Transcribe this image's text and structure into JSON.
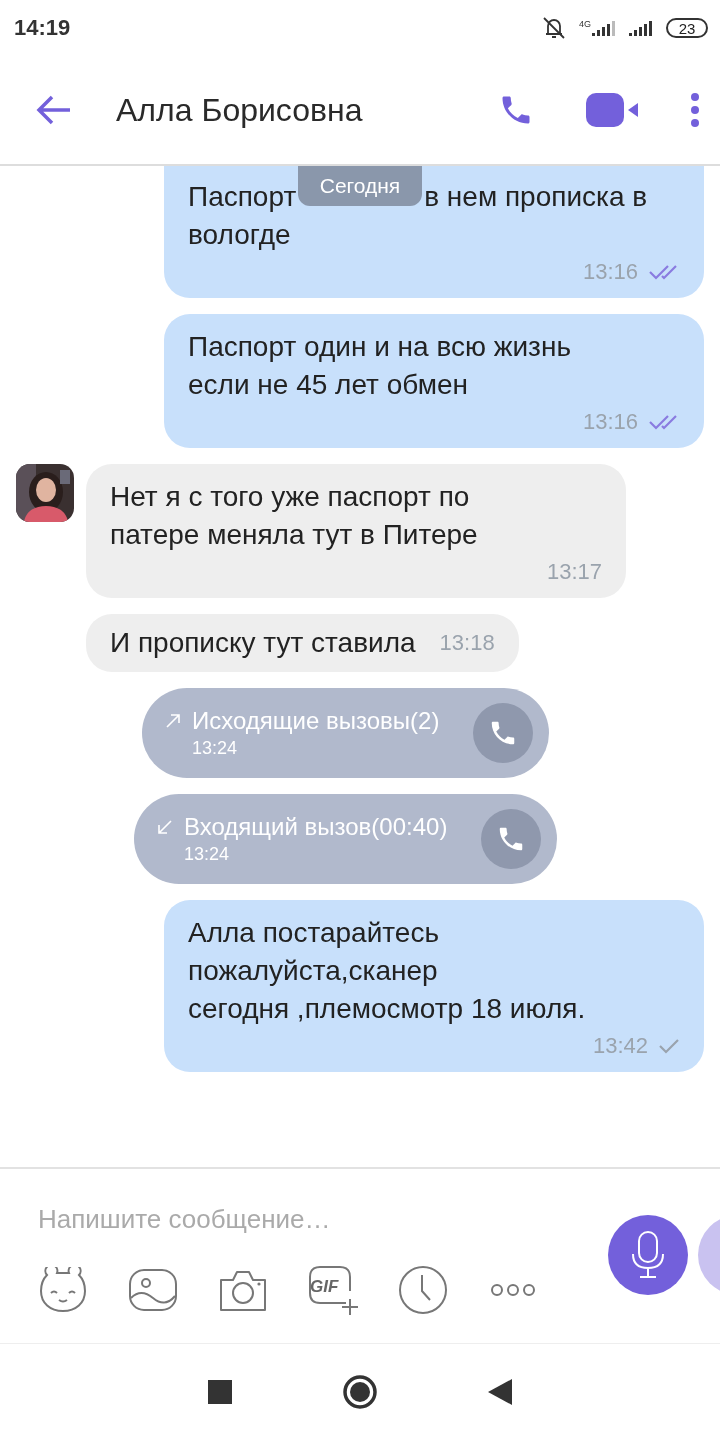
{
  "status_bar": {
    "time": "14:19",
    "network": "4G",
    "battery": "23"
  },
  "header": {
    "title": "Алла Борисовна"
  },
  "date_chip": "Сегодня",
  "messages": [
    {
      "kind": "outgoing",
      "text": "Паспорт",
      "text_continued": "в нем прописка в",
      "text_line2": "вологде",
      "time": "13:16",
      "read": true
    },
    {
      "kind": "outgoing",
      "text": "Паспорт один и на всю жизнь\nесли не 45 лет обмен",
      "time": "13:16",
      "read": true
    },
    {
      "kind": "incoming",
      "avatar": true,
      "text": "Нет я с того уже паспорт по\nпатере меняла тут в Питере",
      "time": "13:17"
    },
    {
      "kind": "incoming",
      "avatar": false,
      "inline_time": true,
      "text": "И прописку тут ставила",
      "time": "13:18"
    },
    {
      "kind": "call",
      "incoming": false,
      "text": "Исходящие вызовы(2)",
      "time": "13:24"
    },
    {
      "kind": "call",
      "incoming": true,
      "text": "Входящий вызов(00:40)",
      "time": "13:24"
    },
    {
      "kind": "outgoing",
      "text": "Алла постарайтесь\nпожалуйста,сканер\nсегодня ,племосмотр 18 июля.",
      "time": "13:42",
      "read": false
    }
  ],
  "composer": {
    "placeholder": "Напишите сообщение…",
    "gif_label": "GIF"
  }
}
